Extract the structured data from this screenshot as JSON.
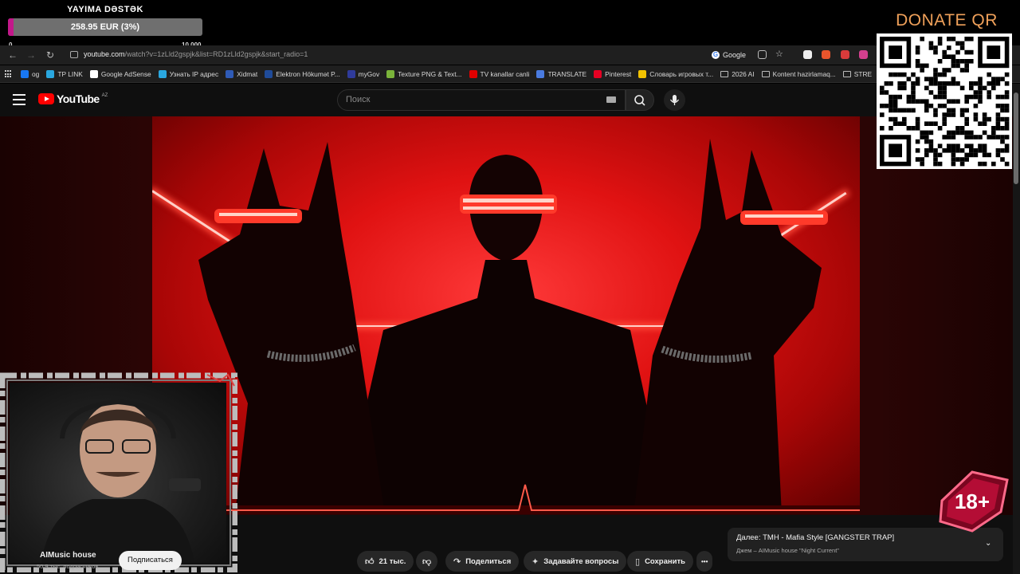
{
  "overlay": {
    "donation_title": "YAYIMA DƏSTƏK",
    "donation_amount": "258.95 EUR (3%)",
    "donation_progress": 0.03,
    "donation_min": "0",
    "donation_max": "10 000",
    "donate_qr_label": "DONATE QR",
    "age_badge": "18+"
  },
  "browser": {
    "url_host": "youtube.com",
    "url_rest": "/watch?v=1zLld2gspjk&list=RD1zLld2gspjk&start_radio=1",
    "search_engine": "Google",
    "bookmarks": [
      {
        "label": "og",
        "color": "#1877f2"
      },
      {
        "label": "TP LINK",
        "color": "#2aa7df"
      },
      {
        "label": "Google AdSense",
        "color": "#ffffff"
      },
      {
        "label": "Узнать IP адрес",
        "color": "#2aa7df"
      },
      {
        "label": "Xidmat",
        "color": "#2f5bb7"
      },
      {
        "label": "Elektron Hökumət P...",
        "color": "#1f4b99"
      },
      {
        "label": "myGov",
        "color": "#2f3b9b"
      },
      {
        "label": "Texture PNG & Text...",
        "color": "#7ab33a"
      },
      {
        "label": "TV kanallar canli",
        "color": "#e00000"
      },
      {
        "label": "TRANSLATE",
        "color": "#4a7be0"
      },
      {
        "label": "Pinterest",
        "color": "#e60023"
      },
      {
        "label": "Словарь игровых т...",
        "color": "#f2c200"
      },
      {
        "label": "2026 AI",
        "folder": true
      },
      {
        "label": "Kontent hazirlamaq...",
        "folder": true
      },
      {
        "label": "STRE",
        "folder": true
      }
    ]
  },
  "youtube": {
    "logo_text": "YouTube",
    "region": "AZ",
    "search_placeholder": "Поиск",
    "channel_name": "AIMusic house",
    "channel_subs": "50,9 тыс. подписчиков",
    "subscribe_label": "Подписаться",
    "likes_label": "21 тыс.",
    "share_label": "Поделиться",
    "ask_label": "Задавайте вопросы",
    "save_label": "Сохранить",
    "more_label": "•••",
    "upnext_title": "Далее: TMH - Mafia Style [GANGSTER TRAP]",
    "upnext_sub": "Джем – AIMusic house \"Night Current\""
  },
  "colors": {
    "accent_red": "#ff0000",
    "donation_fill": "#c2188a",
    "donate_label": "#f0a15a"
  }
}
